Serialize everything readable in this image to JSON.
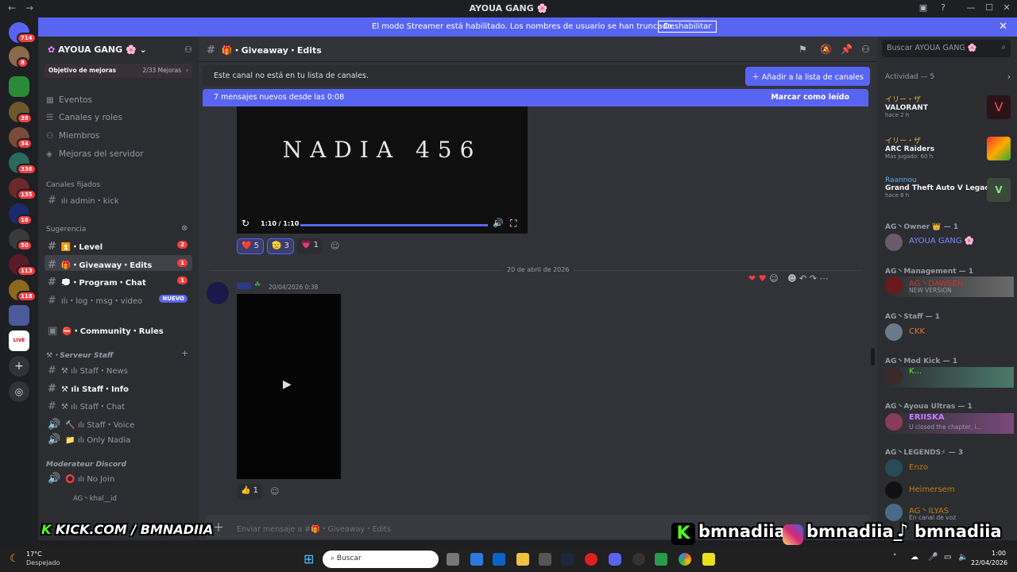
{
  "window": {
    "title": "AYOUA GANG",
    "title_emoji": "🌸"
  },
  "streamer": {
    "text": "El modo Streamer está habilitado. Los nombres de usuario se han truncado.",
    "button": "Deshabilitar"
  },
  "servers": {
    "badges": [
      "714",
      "8",
      "38",
      "34",
      "336",
      "135",
      "16",
      "50",
      "113",
      "118"
    ],
    "live_label": "LIVE"
  },
  "sidebar": {
    "server_name": "AYOUA GANG",
    "boost_goal": "Objetivo de mejoras",
    "boost_count": "2/33 Mejoras",
    "items": [
      "Eventos",
      "Canales y roles",
      "Miembros",
      "Mejoras del servidor"
    ],
    "pinned_label": "Canales fijados",
    "pinned_channel": "ılı admin・kick",
    "suggest_label": "Sugerencia",
    "channels": [
      {
        "name": "⏫・Level",
        "badge": "2"
      },
      {
        "name": "🎁・Giveaway・Edits",
        "badge": "1"
      },
      {
        "name": "💭・Program・Chat",
        "badge": "1"
      },
      {
        "name": "ılı・log・msg・video",
        "badge": "NUEVO"
      }
    ],
    "community": "⛔・Community・Rules",
    "cat_staff": "⚒・Serveur Staff",
    "staff_channels": [
      "⚒ ılı Staff・News",
      "⚒ ılı Staff・Info",
      "⚒ ılı Staff・Chat",
      "🔨 ılı Staff・Voice",
      "📁 ılı Only Nadia"
    ],
    "cat_mod": "Moderateur Discord",
    "mod_channels": [
      "⭕ ılı No Join",
      "AG丶khal__id"
    ]
  },
  "header": {
    "channel": "🎁・Giveaway・Edits",
    "search_placeholder": "Buscar AYOUA GANG 🌸"
  },
  "notice": {
    "text": "Este canal no está en tu lista de canales.",
    "button": "＋ Añadir a la lista de canales"
  },
  "newmsgs": {
    "text": "7 mensajes nuevos desde las 0:08",
    "action": "Marcar como leído"
  },
  "video1": {
    "title": "NADIA 456",
    "time": "1:10 / 1:10",
    "progress": 1.0
  },
  "reactions1": [
    {
      "emoji": "❤️",
      "count": "5"
    },
    {
      "emoji": "🫡",
      "count": "3"
    },
    {
      "emoji": "💗",
      "count": "1"
    }
  ],
  "date_divider": "20 de abril de 2026",
  "message2": {
    "timestamp": "20/04/2026 0:38"
  },
  "reactions2": [
    {
      "emoji": "👍",
      "count": "1"
    }
  ],
  "composer": {
    "placeholder": "Enviar mensaje a #🎁・Giveaway・Edits"
  },
  "members": {
    "activity_label": "Actividad — 5",
    "activities": [
      {
        "user": "イリー・ザ",
        "game": "VALORANT",
        "meta": "hace 2 h"
      },
      {
        "user": "イリー・ザ",
        "game": "ARC Raiders",
        "meta": "Más jugado: 60 h"
      },
      {
        "user": "Raannou",
        "game": "Grand Theft Auto V Legacy",
        "meta": "hace 6 h"
      }
    ],
    "groups": [
      {
        "role": "AG丶Owner 👑 — 1",
        "members": [
          {
            "name": "AYOUA GANG 🌸",
            "status": "",
            "color": "#7b8cff"
          }
        ]
      },
      {
        "role": "AG丶Management — 1",
        "members": [
          {
            "name": "AG丶DAWSEN",
            "status": "NEW VERSION",
            "color": "#d03030"
          }
        ]
      },
      {
        "role": "AG丶Staff — 1",
        "members": [
          {
            "name": "CKK",
            "status": "",
            "color": "#e67e22"
          }
        ]
      },
      {
        "role": "AG丶Mod Kick — 1",
        "members": [
          {
            "name": "K...",
            "status": "",
            "color": "#53fc18"
          }
        ]
      },
      {
        "role": "AG丶Ayoua Ultras — 1",
        "members": [
          {
            "name": "ERIISKA",
            "status": "U closed the chapter, i...",
            "color": "#c27cff"
          }
        ]
      },
      {
        "role": "AG丶LEGENDS⚡ — 3",
        "members": [
          {
            "name": "Enzo",
            "status": "",
            "color": "#c27c0e"
          },
          {
            "name": "Heimersem",
            "status": "",
            "color": "#c27c0e"
          },
          {
            "name": "AG丶ILYAS",
            "status": "En canal de voz",
            "color": "#c27c0e"
          }
        ]
      }
    ]
  },
  "overlay": {
    "kick": "KICK.COM / BMNADIIA",
    "handle1": "bmnadiia",
    "handle2": "bmnadiia_",
    "handle3": "bmnadiia"
  },
  "taskbar": {
    "temp": "17°C",
    "weather": "Despejado",
    "search": "Buscar",
    "time": "1:00",
    "date": "22/04/2026"
  }
}
